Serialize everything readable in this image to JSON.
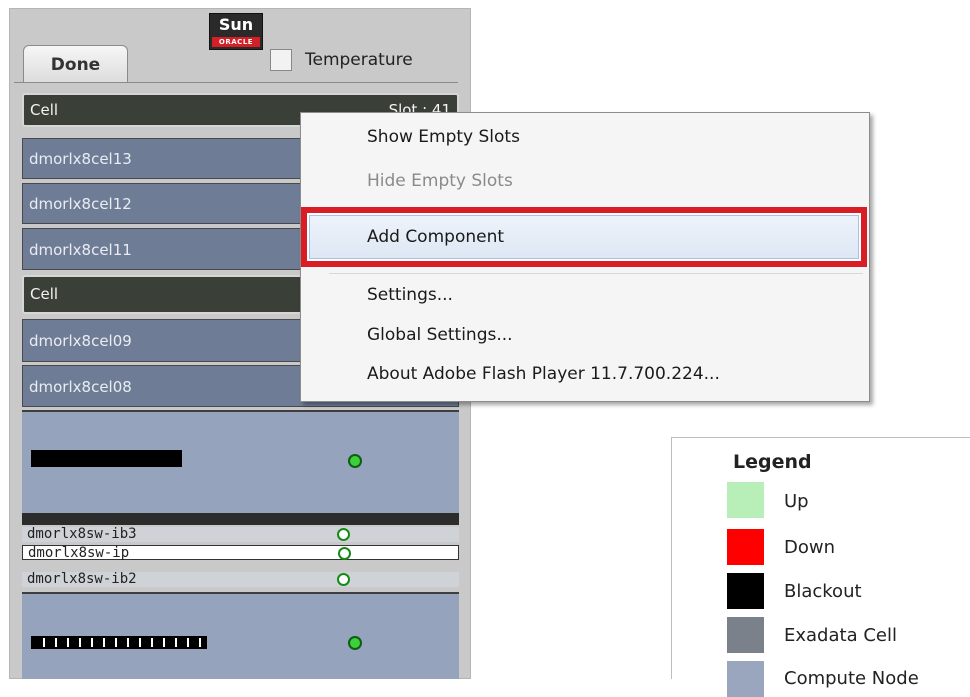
{
  "rack": {
    "logo": {
      "brand": "Sun",
      "sub": "ORACLE"
    },
    "done_label": "Done",
    "temperature_label": "Temperature",
    "temperature_checked": false,
    "slots": [
      {
        "type": "header",
        "label": "Cell",
        "info": "Slot : 41"
      },
      {
        "type": "cell",
        "label": "dmorlx8cel13"
      },
      {
        "type": "cell",
        "label": "dmorlx8cel12"
      },
      {
        "type": "cell",
        "label": "dmorlx8cel11"
      },
      {
        "type": "header",
        "label": "Cell"
      },
      {
        "type": "cell",
        "label": "dmorlx8cel09"
      },
      {
        "type": "cell",
        "label": "dmorlx8cel08"
      }
    ],
    "switches": [
      {
        "label": "dmorlx8sw-ib3"
      },
      {
        "label": "dmorlx8sw-ip"
      },
      {
        "label": "dmorlx8sw-ib2"
      }
    ]
  },
  "context_menu": {
    "items": [
      {
        "label": "Show Empty Slots",
        "enabled": true
      },
      {
        "label": "Hide Empty Slots",
        "enabled": false
      },
      {
        "label": "Add Component",
        "enabled": true,
        "highlighted": true
      },
      {
        "label": "Settings...",
        "enabled": true
      },
      {
        "label": "Global Settings...",
        "enabled": true
      },
      {
        "label": "About Adobe Flash Player 11.7.700.224...",
        "enabled": true
      }
    ]
  },
  "legend": {
    "title": "Legend",
    "entries": [
      {
        "label": "Up",
        "color": "#b8efb8"
      },
      {
        "label": "Down",
        "color": "#ff0000"
      },
      {
        "label": "Blackout",
        "color": "#000000"
      },
      {
        "label": "Exadata Cell",
        "color": "#7b818b"
      },
      {
        "label": "Compute Node",
        "color": "#9aa6bd"
      }
    ]
  },
  "colors": {
    "highlight_border": "#d91d24",
    "status_up": "#3ad13a",
    "cell_bg": "#6e7d95",
    "compute_bg": "#95a3bd"
  }
}
